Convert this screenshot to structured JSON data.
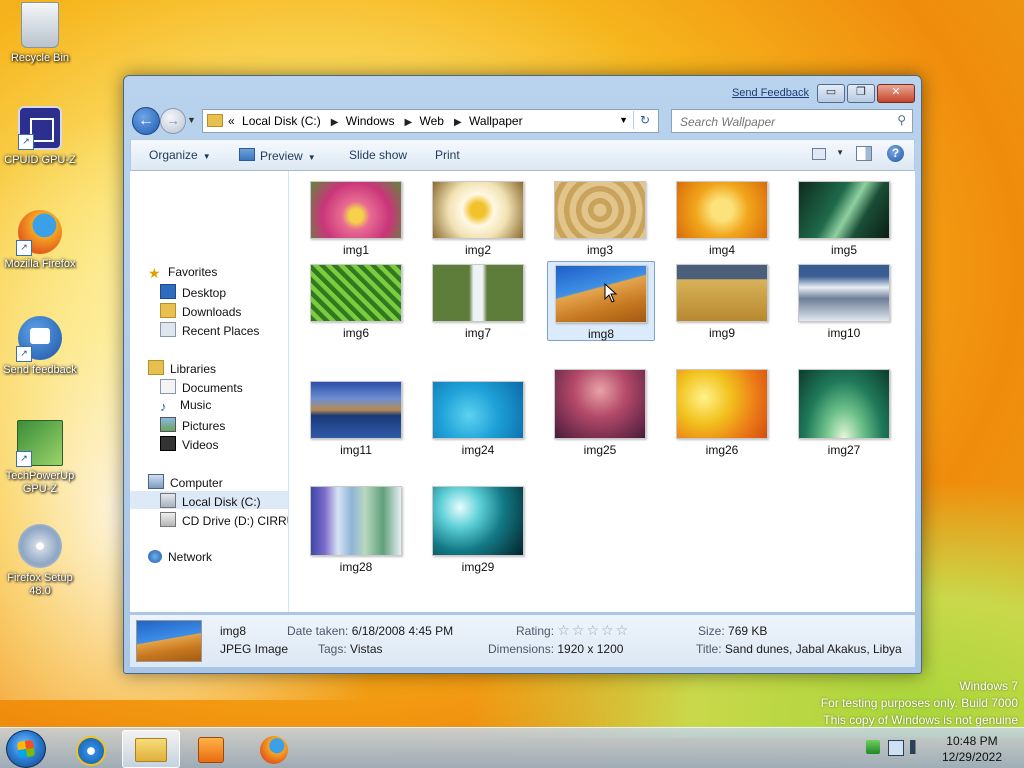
{
  "desktop": {
    "icons": [
      {
        "label": "Recycle Bin"
      },
      {
        "label": "CPUID GPU-Z"
      },
      {
        "label": "Mozilla Firefox"
      },
      {
        "label": "Send feedback"
      },
      {
        "label": "TechPowerUp GPU-Z"
      },
      {
        "label": "Firefox Setup 48.0"
      }
    ],
    "watermark": [
      "Windows 7",
      "For testing purposes only. Build 7000",
      "This copy of Windows is not genuine"
    ]
  },
  "window": {
    "send_feedback": "Send Feedback",
    "caption": {
      "minimize": "▭",
      "maximize": "❐",
      "close": "✕"
    },
    "address": {
      "overflow": "«",
      "crumbs": [
        "Local Disk (C:)",
        "Windows",
        "Web",
        "Wallpaper"
      ]
    },
    "search": {
      "placeholder": "Search Wallpaper"
    },
    "toolbar": {
      "organize": "Organize",
      "preview": "Preview",
      "slideshow": "Slide show",
      "print": "Print",
      "help": "?"
    },
    "nav": {
      "favorites": "Favorites",
      "desktop": "Desktop",
      "downloads": "Downloads",
      "recent": "Recent Places",
      "libraries": "Libraries",
      "documents": "Documents",
      "music": "Music",
      "pictures": "Pictures",
      "videos": "Videos",
      "computer": "Computer",
      "local_disk": "Local Disk (C:)",
      "cd_drive": "CD Drive (D:) CIRRUS",
      "network": "Network"
    },
    "files": [
      {
        "name": "img1"
      },
      {
        "name": "img2"
      },
      {
        "name": "img3"
      },
      {
        "name": "img4"
      },
      {
        "name": "img5"
      },
      {
        "name": "img6"
      },
      {
        "name": "img7"
      },
      {
        "name": "img8",
        "selected": true
      },
      {
        "name": "img9"
      },
      {
        "name": "img10"
      },
      {
        "name": "img11"
      },
      {
        "name": "img24"
      },
      {
        "name": "img25"
      },
      {
        "name": "img26"
      },
      {
        "name": "img27"
      },
      {
        "name": "img28"
      },
      {
        "name": "img29"
      }
    ],
    "details": {
      "name": "img8",
      "type": "JPEG Image",
      "date_taken_label": "Date taken:",
      "date_taken": "6/18/2008 4:45 PM",
      "tags_label": "Tags:",
      "tags": "Vistas",
      "rating_label": "Rating:",
      "rating_stars": "☆☆☆☆☆",
      "dimensions_label": "Dimensions:",
      "dimensions": "1920 x 1200",
      "size_label": "Size:",
      "size": "769 KB",
      "title_label": "Title:",
      "title": "Sand dunes, Jabal Akakus, Libya"
    }
  },
  "taskbar": {
    "time": "10:48 PM",
    "date": "12/29/2022",
    "apps": [
      "ie-icon",
      "explorer-icon",
      "media-player-icon",
      "firefox-icon"
    ]
  }
}
